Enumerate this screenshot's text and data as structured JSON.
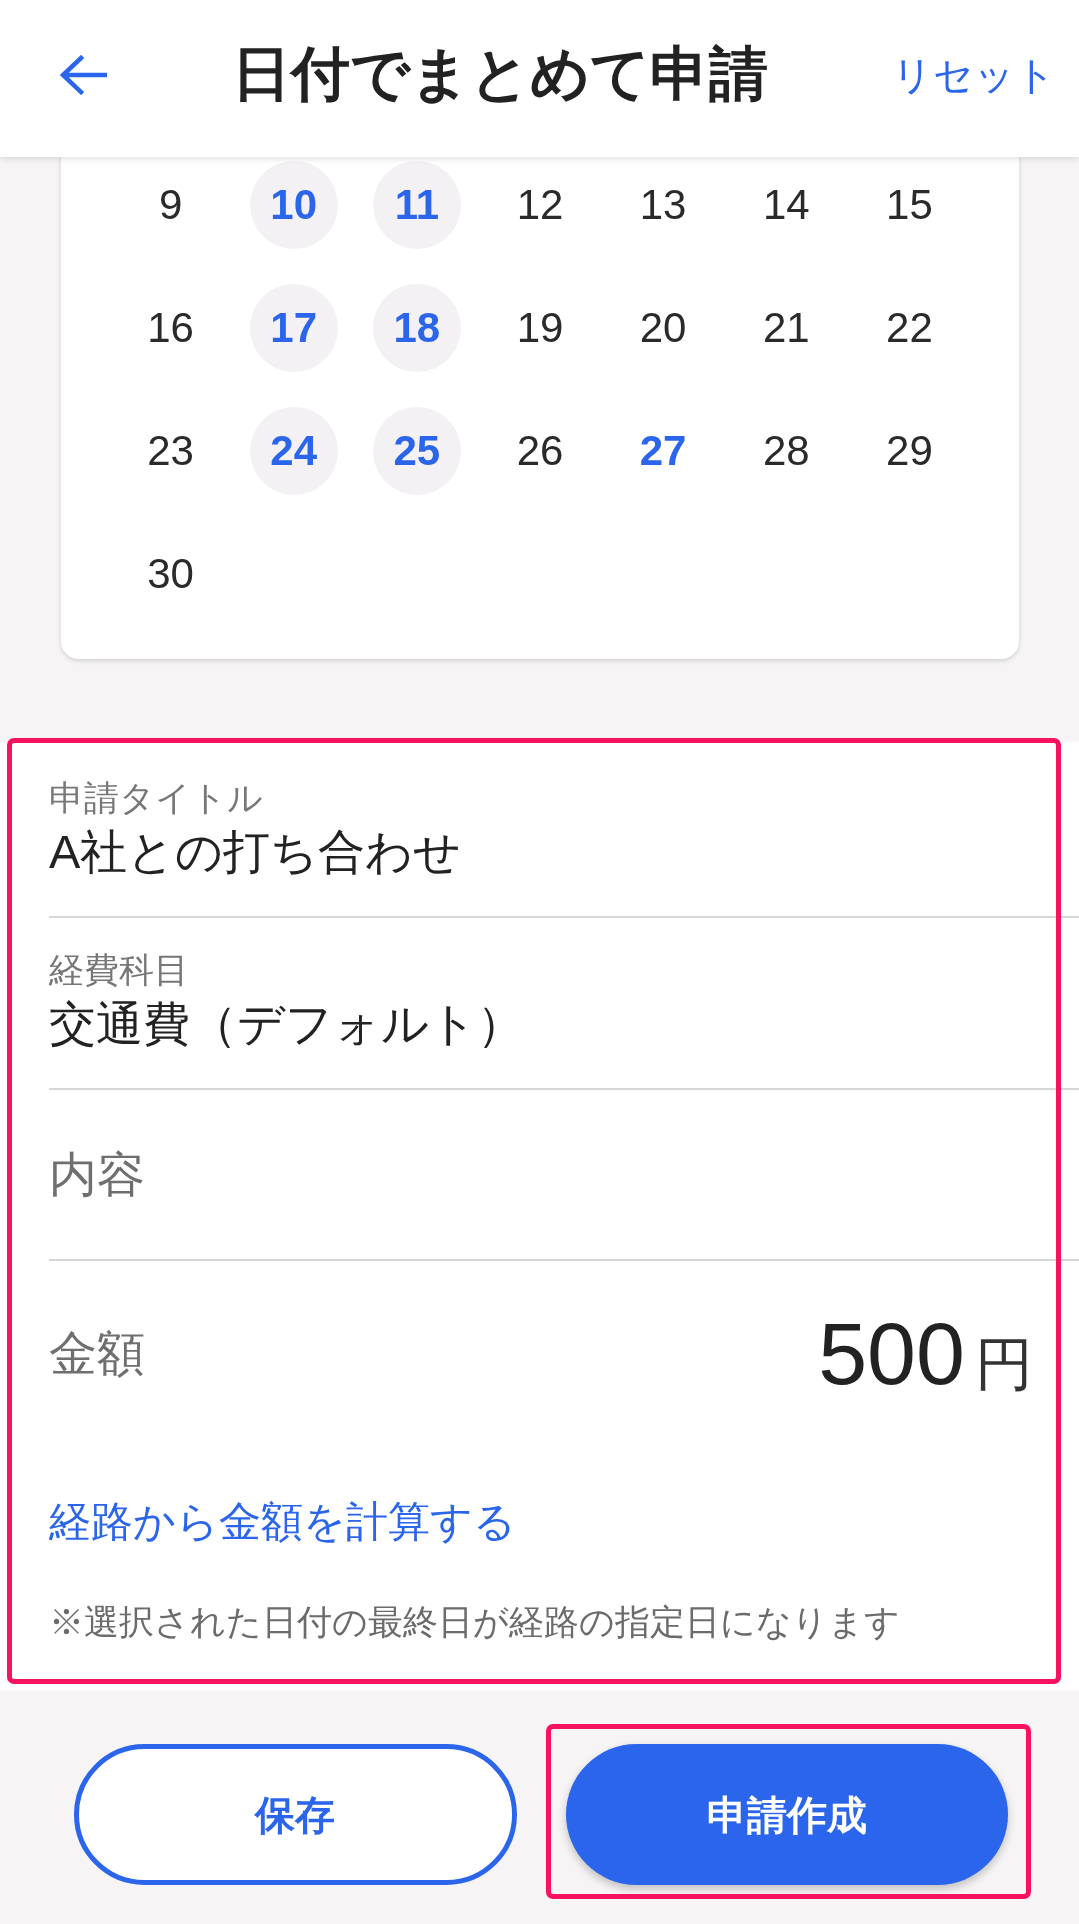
{
  "header": {
    "title": "日付でまとめて申請",
    "action": "リセット"
  },
  "calendar": {
    "weeks": [
      [
        {
          "day": "9",
          "selected": false,
          "today": false
        },
        {
          "day": "10",
          "selected": true,
          "today": false
        },
        {
          "day": "11",
          "selected": true,
          "today": false
        },
        {
          "day": "12",
          "selected": false,
          "today": false
        },
        {
          "day": "13",
          "selected": false,
          "today": false
        },
        {
          "day": "14",
          "selected": false,
          "today": false
        },
        {
          "day": "15",
          "selected": false,
          "today": false
        }
      ],
      [
        {
          "day": "16",
          "selected": false,
          "today": false
        },
        {
          "day": "17",
          "selected": true,
          "today": false
        },
        {
          "day": "18",
          "selected": true,
          "today": false
        },
        {
          "day": "19",
          "selected": false,
          "today": false
        },
        {
          "day": "20",
          "selected": false,
          "today": false
        },
        {
          "day": "21",
          "selected": false,
          "today": false
        },
        {
          "day": "22",
          "selected": false,
          "today": false
        }
      ],
      [
        {
          "day": "23",
          "selected": false,
          "today": false
        },
        {
          "day": "24",
          "selected": true,
          "today": false
        },
        {
          "day": "25",
          "selected": true,
          "today": false
        },
        {
          "day": "26",
          "selected": false,
          "today": false
        },
        {
          "day": "27",
          "selected": false,
          "today": true
        },
        {
          "day": "28",
          "selected": false,
          "today": false
        },
        {
          "day": "29",
          "selected": false,
          "today": false
        }
      ],
      [
        {
          "day": "30",
          "selected": false,
          "today": false
        }
      ]
    ]
  },
  "form": {
    "highlighted": true,
    "fields": [
      {
        "kind": "filled",
        "label": "申請タイトル",
        "value": "A社との打ち合わせ"
      },
      {
        "kind": "filled",
        "label": "経費科目",
        "value": "交通費（デフォルト）"
      },
      {
        "kind": "empty",
        "placeholder": "内容"
      }
    ],
    "amount": {
      "label": "金額",
      "value": "500",
      "unit": "円"
    },
    "route_link": "経路から金額を計算する",
    "note": "※選択された日付の最終日が経路の指定日になります"
  },
  "buttons": [
    {
      "label": "保存",
      "kind": "outline",
      "highlighted": false
    },
    {
      "label": "申請作成",
      "kind": "filled",
      "highlighted": true
    }
  ]
}
